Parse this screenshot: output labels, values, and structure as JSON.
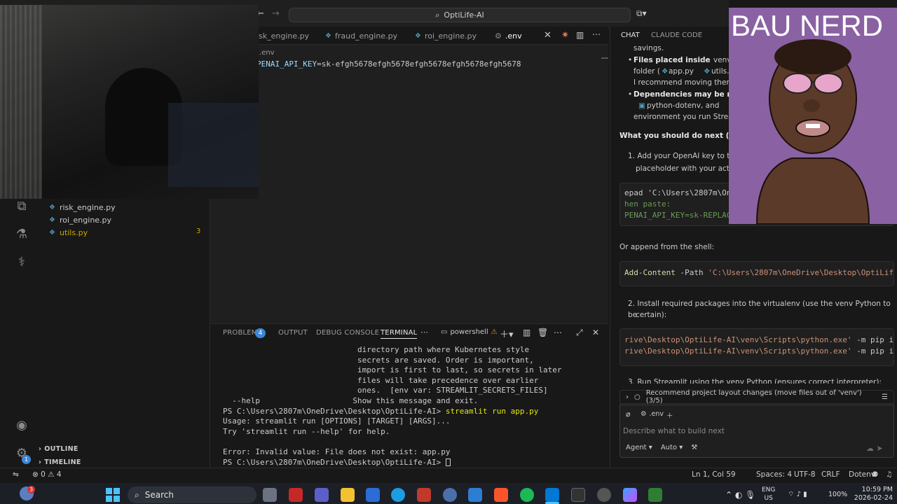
{
  "titlebar": {
    "search_label": "OptiLife-AI"
  },
  "editor": {
    "tabs": [
      {
        "label": "sk_engine.py"
      },
      {
        "label": "fraud_engine.py"
      },
      {
        "label": "roi_engine.py"
      },
      {
        "label": ".env"
      }
    ],
    "breadcrumb": ".env",
    "code_key": "PENAI_API_KEY",
    "code_value": "=sk-efgh5678efgh5678efgh5678efgh5678efgh5678"
  },
  "sidebar": {
    "files": [
      {
        "label": "risk_engine.py"
      },
      {
        "label": "roi_engine.py"
      },
      {
        "label": "utils.py"
      }
    ],
    "utils_badge": "3",
    "outline_label": "OUTLINE",
    "timeline_label": "TIMELINE"
  },
  "panel": {
    "tabs": {
      "problems": "PROBLEMS",
      "output": "OUTPUT",
      "debug": "DEBUG CONSOLE",
      "terminal": "TERMINAL"
    },
    "problems_count": "4",
    "shell_label": "powershell",
    "terminal_lines": [
      "                             directory path where Kubernetes style",
      "                             secrets are saved. Order is important,",
      "                             import is first to last, so secrets in later",
      "                             files will take precedence over earlier",
      "                             ones.  [env var: STREAMLIT_SECRETS_FILES]",
      "  --help                    Show this message and exit."
    ],
    "prompt1": "PS C:\\Users\\2807m\\OneDrive\\Desktop\\OptiLife-AI> ",
    "cmd1": "streamlit run app.py",
    "usage": "Usage: streamlit run [OPTIONS] [TARGET] [ARGS]...",
    "try": "Try 'streamlit run --help' for help.",
    "error": "Error: Invalid value: File does not exist: app.py",
    "prompt2": "PS C:\\Users\\2807m\\OneDrive\\Desktop\\OptiLife-AI> "
  },
  "chat": {
    "tab_chat": "CHAT",
    "tab_claude": "CLAUDE CODE",
    "savings": "savings.",
    "files_placed": "Files placed inside",
    "venv": "venv",
    "folder_prefix": "folder (",
    "app_py": "app.py",
    "utils_p": "utils.p",
    "recommend": "I recommend moving them t",
    "deps": "Dependencies may be miss",
    "python_dotenv": "python-dotenv",
    "and": ", and",
    "environment": "environment you run Stream",
    "next_heading": "What you should do next (copy",
    "step1a": "1. Add your OpenAI key to the",
    "step1b": "placeholder with your actua",
    "code1": [
      "epad 'C:\\Users\\2807m\\One",
      "hen paste:",
      "PENAI_API_KEY=sk-REPLACE"
    ],
    "append": "Or append from the shell:",
    "code2_cmd": "Add-Content",
    "code2_flag": " -Path ",
    "code2_str": "'C:\\Users\\2807m\\OneDrive\\Desktop\\OptiLife",
    "step2a": "2. Install required packages into the virtualenv (use the venv Python to be",
    "step2b": "certain):",
    "code3": [
      "rive\\Desktop\\OptiLife-AI\\venv\\Scripts\\python.exe'",
      "rive\\Desktop\\OptiLife-AI\\venv\\Scripts\\python.exe'"
    ],
    "code3_tail": " -m pip in",
    "step3": "3. Run Streamlit using the venv Python (ensures correct interpreter):",
    "todo": "Recommend project layout changes (move files out of 'venv') (3/5)",
    "context_chip": ".env",
    "input_placeholder": "Describe what to build next",
    "agent_label": "Agent",
    "auto_label": "Auto"
  },
  "statusbar": {
    "errors": "0",
    "warnings": "4",
    "position": "Ln 1, Col 59",
    "spaces": "Spaces: 4",
    "encoding": "UTF-8",
    "eol": "CRLF",
    "language": "Dotenv"
  },
  "taskbar": {
    "search": "Search",
    "lang1": "ENG",
    "lang2": "US",
    "battery": "100%",
    "time": "10:59 PM",
    "date": "2026-02-24",
    "weather_badge": "3"
  },
  "overlay": {
    "avatar_name": "BAU NERD"
  },
  "colors": {
    "accent": "#3b87d8",
    "warning": "#cca700",
    "avatar_bg": "#8a62a3"
  }
}
